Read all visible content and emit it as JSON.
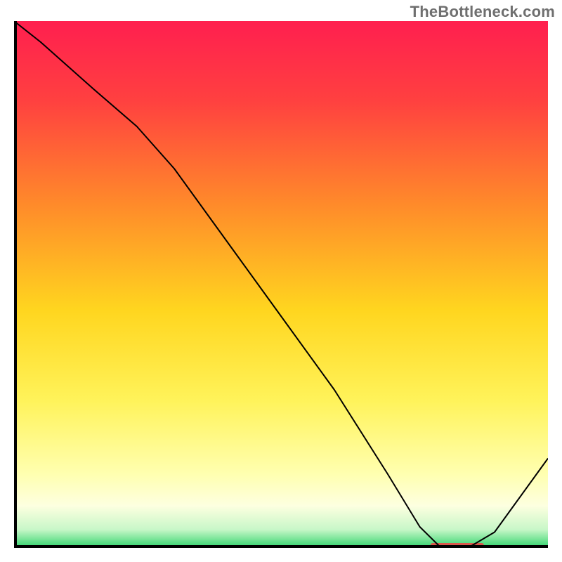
{
  "attribution": "TheBottleneck.com",
  "mini_label": "",
  "chart_data": {
    "type": "line",
    "title": "",
    "xlabel": "",
    "ylabel": "",
    "xlim": [
      0,
      100
    ],
    "ylim": [
      0,
      100
    ],
    "background": {
      "type": "vertical-gradient",
      "stops": [
        {
          "pos": 0.0,
          "color": "#ff1f4f"
        },
        {
          "pos": 0.15,
          "color": "#ff4040"
        },
        {
          "pos": 0.35,
          "color": "#ff8b2a"
        },
        {
          "pos": 0.55,
          "color": "#ffd61f"
        },
        {
          "pos": 0.72,
          "color": "#fff35a"
        },
        {
          "pos": 0.86,
          "color": "#ffffb0"
        },
        {
          "pos": 0.92,
          "color": "#fdffe0"
        },
        {
          "pos": 0.965,
          "color": "#c8f7c8"
        },
        {
          "pos": 1.0,
          "color": "#2fd36b"
        }
      ]
    },
    "series": [
      {
        "name": "curve",
        "color": "#000000",
        "stroke_width": 2,
        "x": [
          0,
          5,
          15,
          23,
          30,
          40,
          50,
          60,
          70,
          76,
          80,
          85,
          90,
          100
        ],
        "y": [
          100,
          96,
          87,
          80,
          72,
          58,
          44,
          30,
          14,
          4,
          0,
          0,
          3,
          17
        ]
      }
    ],
    "marker": {
      "x_start": 78,
      "x_end": 88,
      "y": 0,
      "color": "#d9574b"
    },
    "axes": {
      "show_ticks": false,
      "show_grid": false,
      "border_color": "#000000",
      "border_width": 4
    }
  }
}
